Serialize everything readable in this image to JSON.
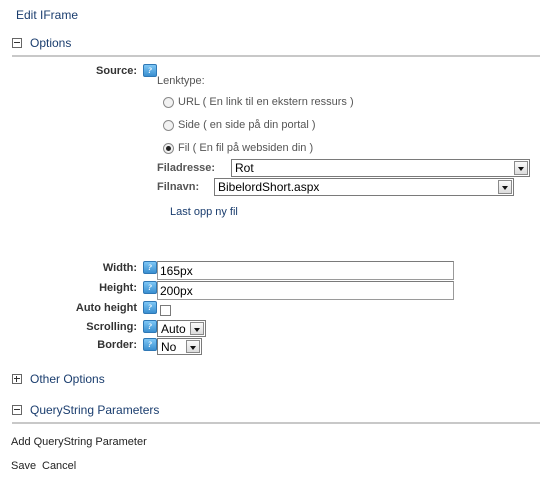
{
  "page": {
    "title": "Edit IFrame"
  },
  "sections": {
    "options": "Options",
    "other_options": "Other Options",
    "querystring": "QueryString Parameters"
  },
  "source": {
    "label": "Source:",
    "linktype_label": "Lenktype:",
    "options": [
      {
        "label": "URL ( En link til en ekstern ressurs )",
        "selected": false
      },
      {
        "label": "Side ( en side på din portal )",
        "selected": false
      },
      {
        "label": "Fil ( En fil på websiden din )",
        "selected": true
      }
    ],
    "filadresse_label": "Filadresse:",
    "filadresse_value": "Rot",
    "filnavn_label": "Filnavn:",
    "filnavn_value": "BibelordShort.aspx",
    "upload_link": "Last opp ny fil"
  },
  "fields": {
    "width_label": "Width:",
    "width_value": "165px",
    "height_label": "Height:",
    "height_value": "200px",
    "auto_height_label": "Auto height",
    "auto_height_checked": false,
    "scrolling_label": "Scrolling:",
    "scrolling_value": "Auto",
    "border_label": "Border:",
    "border_value": "No"
  },
  "actions": {
    "add_param": "Add QueryString Parameter",
    "save": "Save",
    "cancel": "Cancel"
  },
  "icons": {
    "help": "help-icon",
    "expand": "plus-icon",
    "collapse": "minus-icon"
  }
}
